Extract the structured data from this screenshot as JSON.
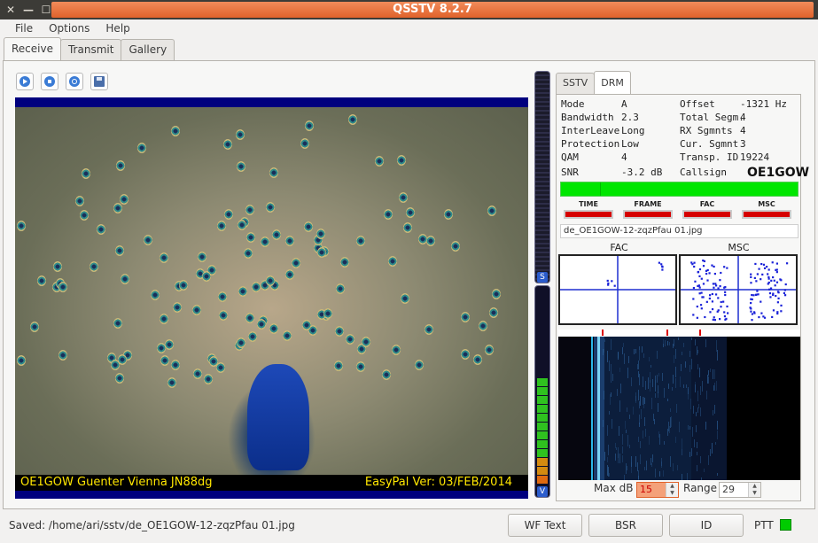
{
  "window": {
    "title": "QSSTV 8.2.7",
    "controls": [
      "close-icon",
      "minimize-icon",
      "maximize-icon"
    ]
  },
  "menu": {
    "items": [
      "File",
      "Options",
      "Help"
    ]
  },
  "tabs": [
    {
      "label": "Receive",
      "active": true
    },
    {
      "label": "Transmit"
    },
    {
      "label": "Gallery"
    }
  ],
  "toolbar": {
    "icons": [
      "play-icon",
      "stop-icon",
      "rotate-icon",
      "save-icon"
    ]
  },
  "image": {
    "caption_left": "OE1GOW Guenter Vienna JN88dg",
    "caption_right": "EasyPal Ver: 03/FEB/2014"
  },
  "vumeter": {
    "top_label": "S",
    "bottom_label": "V"
  },
  "subtabs": [
    {
      "label": "SSTV"
    },
    {
      "label": "DRM",
      "active": true
    }
  ],
  "drm": {
    "left": [
      {
        "key": "Mode",
        "value": "A"
      },
      {
        "key": "Bandwidth",
        "value": "2.3"
      },
      {
        "key": "InterLeave",
        "value": "Long"
      },
      {
        "key": "Protection",
        "value": "Low"
      },
      {
        "key": "QAM",
        "value": "4"
      },
      {
        "key": "SNR",
        "value": "-3.2 dB"
      }
    ],
    "right": [
      {
        "key": "Offset",
        "value": "-1321 Hz"
      },
      {
        "key": "Total Segm.",
        "value": "4"
      },
      {
        "key": "RX  Sgmnts",
        "value": "4"
      },
      {
        "key": "Cur. Sgmnt",
        "value": "3"
      },
      {
        "key": "Transp. ID",
        "value": "19224"
      },
      {
        "key": "Callsign",
        "value": "OE1GOW"
      }
    ],
    "indicators": [
      {
        "label": "TIME",
        "color": "#d60000"
      },
      {
        "label": "FRAME",
        "color": "#d60000"
      },
      {
        "label": "FAC",
        "color": "#d60000"
      },
      {
        "label": "MSC",
        "color": "#d60000"
      }
    ],
    "filename": "de_OE1GOW-12-zqzPfau 01.jpg",
    "fac_label": "FAC",
    "msc_label": "MSC"
  },
  "waterfall": {
    "max_db_label": "Max dB",
    "max_db_value": "15",
    "range_label": "Range",
    "range_value": "29"
  },
  "status": {
    "saved_text": "Saved: /home/ari/sstv/de_OE1GOW-12-zqzPfau 01.jpg",
    "buttons": [
      "WF Text",
      "BSR",
      "ID"
    ],
    "ptt_label": "PTT",
    "ptt_color": "#00cc00"
  }
}
